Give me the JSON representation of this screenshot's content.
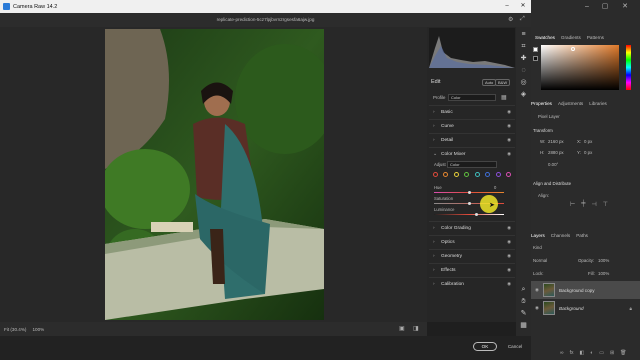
{
  "window": {
    "title": "Camera Raw 14.2",
    "filename": "replicate-prediction-5cz7lpjbvrn2rgsesfa6ajw.jpg"
  },
  "status_bar": {
    "fit_label": "Fit (30.4%)",
    "zoom_label": "100%"
  },
  "edit_panel": {
    "title": "Edit",
    "auto_label": "Auto",
    "bw_label": "B&W",
    "profile_label": "Profile",
    "profile_value": "Color",
    "sections": [
      "Basic",
      "Curve",
      "Detail"
    ],
    "color_mixer": {
      "title": "Color Mixer",
      "adjust_label": "Adjust",
      "adjust_value": "Color",
      "swatch_colors": [
        "#e04a3a",
        "#e6862e",
        "#e6cf3a",
        "#5fbf3f",
        "#3fbfbf",
        "#3f6fd8",
        "#8a4fd8",
        "#d84fb0"
      ],
      "hue_label": "Hue",
      "hue_value": "0",
      "saturation_label": "Saturation",
      "luminance_label": "Luminance"
    },
    "sections_after": [
      "Color Grading",
      "Optics",
      "Geometry",
      "Effects",
      "Calibration"
    ]
  },
  "footer": {
    "ok_label": "OK",
    "cancel_label": "Cancel"
  },
  "photoshop": {
    "swatch_tabs": [
      "Swatches",
      "Gradients",
      "Patterns"
    ],
    "prop_tabs": [
      "Properties",
      "Adjustments",
      "Libraries"
    ],
    "pixel_layer": "Pixel Layer",
    "transform_label": "Transform",
    "w_label": "W:",
    "w_value": "2160 px",
    "h_label": "H:",
    "h_value": "2880 px",
    "x_label": "X:",
    "x_value": "0 px",
    "y_label": "Y:",
    "y_value": "0 px",
    "angle_value": "0.00°",
    "align_label": "Align and Distribute",
    "align_sub": "Align:",
    "layer_tabs": [
      "Layers",
      "Channels",
      "Paths"
    ],
    "kind_label": "Kind",
    "blend_label": "Normal",
    "opacity_label": "Opacity:",
    "opacity_value": "100%",
    "lock_label": "Lock:",
    "fill_label": "Fill:",
    "fill_value": "100%",
    "layers": [
      "Background copy",
      "Background"
    ],
    "accent": "#e07a2a"
  }
}
